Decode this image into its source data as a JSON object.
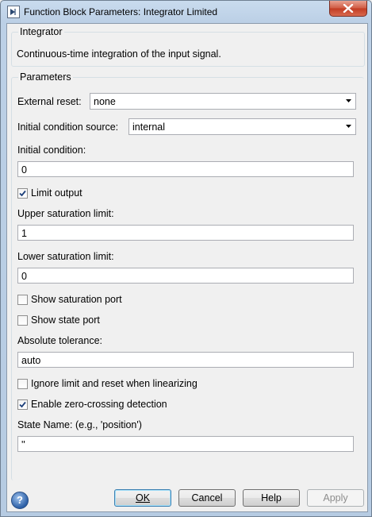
{
  "window": {
    "title": "Function Block Parameters: Integrator Limited"
  },
  "block": {
    "name": "Integrator",
    "description": "Continuous-time integration of the input signal."
  },
  "params": {
    "legend": "Parameters",
    "external_reset_label": "External reset:",
    "external_reset_value": "none",
    "ic_source_label": "Initial condition source:",
    "ic_source_value": "internal",
    "ic_label": "Initial condition:",
    "ic_value": "0",
    "limit_output_label": "Limit output",
    "limit_output_checked": true,
    "upper_label": "Upper saturation limit:",
    "upper_value": "1",
    "lower_label": "Lower saturation limit:",
    "lower_value": "0",
    "show_sat_port_label": "Show saturation port",
    "show_sat_port_checked": false,
    "show_state_port_label": "Show state port",
    "show_state_port_checked": false,
    "abs_tol_label": "Absolute tolerance:",
    "abs_tol_value": "auto",
    "ignore_limit_label": "Ignore limit and reset when linearizing",
    "ignore_limit_checked": false,
    "zero_cross_label": "Enable zero-crossing detection",
    "zero_cross_checked": true,
    "state_name_label": "State Name: (e.g., 'position')",
    "state_name_value": "''"
  },
  "buttons": {
    "ok": "OK",
    "cancel": "Cancel",
    "help": "Help",
    "apply": "Apply"
  },
  "icons": {
    "help": "help-icon",
    "close": "close-icon",
    "app": "simulink-block-icon"
  }
}
